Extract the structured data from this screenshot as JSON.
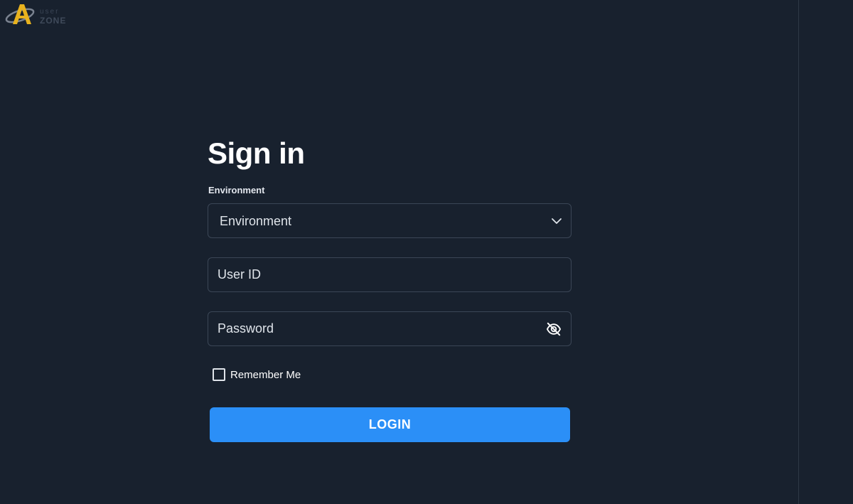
{
  "logo": {
    "word_top": "user",
    "word_bottom": "ZONE",
    "mark_color": "#e8b21e"
  },
  "form": {
    "title": "Sign in",
    "environment": {
      "label": "Environment",
      "selected": "Environment",
      "icon": "chevron-down-icon"
    },
    "user_id": {
      "placeholder": "User ID",
      "value": ""
    },
    "password": {
      "placeholder": "Password",
      "value": "",
      "icon": "eye-off-icon"
    },
    "remember_me": {
      "label": "Remember Me",
      "checked": false
    },
    "login_button": "LOGIN"
  },
  "colors": {
    "background": "#18212e",
    "field_border": "#3b4656",
    "primary": "#2b8ff7"
  }
}
